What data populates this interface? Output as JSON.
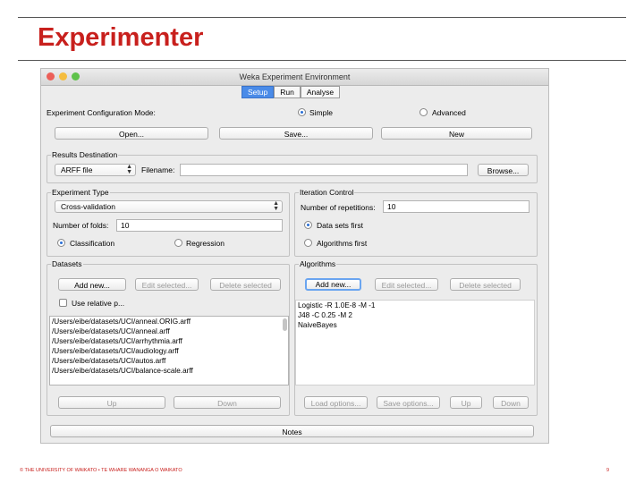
{
  "slide": {
    "title": "Experimenter",
    "footer": "© THE UNIVERSITY OF WAIKATO • TE WHARE WANANGA O WAIKATO",
    "page_number": "9"
  },
  "window": {
    "title": "Weka Experiment Environment",
    "tabs": [
      {
        "label": "Setup",
        "active": true
      },
      {
        "label": "Run",
        "active": false
      },
      {
        "label": "Analyse",
        "active": false
      }
    ]
  },
  "config": {
    "mode_label": "Experiment Configuration Mode:",
    "simple_label": "Simple",
    "advanced_label": "Advanced",
    "open_label": "Open...",
    "save_label": "Save...",
    "new_label": "New"
  },
  "results": {
    "group_title": "Results Destination",
    "format_value": "ARFF file",
    "filename_label": "Filename:",
    "filename_value": "",
    "browse_label": "Browse..."
  },
  "experiment_type": {
    "group_title": "Experiment Type",
    "type_value": "Cross-validation",
    "folds_label": "Number of folds:",
    "folds_value": "10",
    "classification_label": "Classification",
    "regression_label": "Regression"
  },
  "iteration": {
    "group_title": "Iteration Control",
    "reps_label": "Number of repetitions:",
    "reps_value": "10",
    "datasets_first_label": "Data sets first",
    "algorithms_first_label": "Algorithms first"
  },
  "datasets": {
    "group_title": "Datasets",
    "add_label": "Add new...",
    "edit_label": "Edit selected...",
    "delete_label": "Delete selected",
    "relative_label": "Use relative p...",
    "items": [
      "/Users/eibe/datasets/UCI/anneal.ORIG.arff",
      "/Users/eibe/datasets/UCI/anneal.arff",
      "/Users/eibe/datasets/UCI/arrhythmia.arff",
      "/Users/eibe/datasets/UCI/audiology.arff",
      "/Users/eibe/datasets/UCI/autos.arff",
      "/Users/eibe/datasets/UCI/balance-scale.arff"
    ],
    "up_label": "Up",
    "down_label": "Down"
  },
  "algorithms": {
    "group_title": "Algorithms",
    "add_label": "Add new...",
    "edit_label": "Edit selected...",
    "delete_label": "Delete selected",
    "items": [
      "Logistic -R 1.0E-8 -M -1",
      "J48 -C 0.25 -M 2",
      "NaiveBayes"
    ],
    "load_label": "Load options...",
    "save_label": "Save options...",
    "up_label": "Up",
    "down_label": "Down"
  },
  "notes_label": "Notes",
  "colors": {
    "title_red": "#c8201d",
    "tab_active": "#4a8be8",
    "radio_selected": "#2a6fd6"
  }
}
